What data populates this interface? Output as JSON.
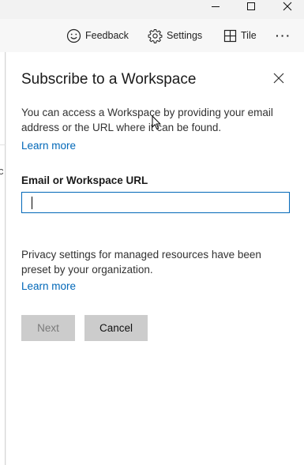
{
  "toolbar": {
    "feedback_label": "Feedback",
    "settings_label": "Settings",
    "tile_label": "Tile",
    "more_label": "···"
  },
  "background": {
    "partial_text": "c"
  },
  "panel": {
    "title": "Subscribe to a Workspace",
    "description": "You can access a Workspace by providing your email address or the URL where it can be found.",
    "learn_more_1": "Learn more",
    "field_label": "Email or Workspace URL",
    "field_value": "",
    "privacy_text": "Privacy settings for managed resources have been preset by your organization.",
    "learn_more_2": "Learn more",
    "next_label": "Next",
    "cancel_label": "Cancel"
  },
  "colors": {
    "accent": "#0067b8",
    "button_bg": "#cccccc",
    "disabled_text": "#7a7a7a"
  },
  "icons": [
    "minimize-icon",
    "maximize-icon",
    "close-icon",
    "smiley-icon",
    "gear-icon",
    "tile-grid-icon",
    "more-icon",
    "dismiss-icon",
    "mouse-pointer-icon"
  ]
}
